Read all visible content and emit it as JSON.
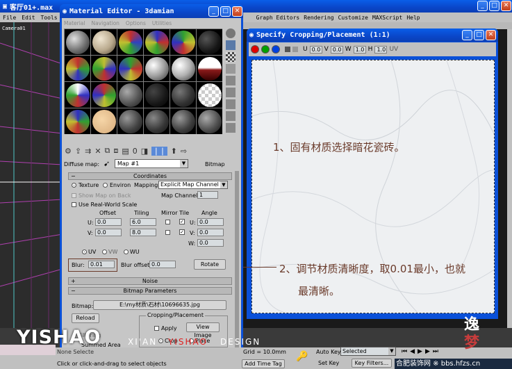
{
  "main": {
    "title": "客厅01+.max",
    "menu": [
      "File",
      "Edit",
      "Tools"
    ],
    "menu_right": [
      "Graph Editors",
      "Rendering",
      "Customize",
      "MAXScript",
      "Help"
    ],
    "viewport_label": "Camera01"
  },
  "material_editor": {
    "title": "Material Editor - 3damian",
    "menu": [
      "Material",
      "Navigation",
      "Options",
      "Utilities"
    ],
    "diffuse_label": "Diffuse map:",
    "map_name": "Map #1",
    "map_type": "Bitmap",
    "coordinates": {
      "header": "Coordinates",
      "texture": "Texture",
      "environ": "Environ",
      "mapping_label": "Mapping:",
      "mapping_value": "Explicit Map Channel",
      "show_map": "Show Map on Back",
      "map_channel_label": "Map Channel:",
      "map_channel": "1",
      "real_world": "Use Real-World Scale",
      "offset": "Offset",
      "tiling": "Tiling",
      "mirror_tile": "Mirror Tile",
      "angle": "Angle",
      "u": "U:",
      "v": "V:",
      "w": "W:",
      "u_offset": "0.0",
      "v_offset": "0.0",
      "u_tiling": "6.0",
      "v_tiling": "8.0",
      "u_angle": "0.0",
      "v_angle": "0.0",
      "w_angle": "0.0",
      "uv": "UV",
      "vw": "VW",
      "wu": "WU",
      "blur_label": "Blur:",
      "blur": "0.01",
      "blur_offset_label": "Blur offset:",
      "blur_offset": "0.0",
      "rotate": "Rotate"
    },
    "noise": "Noise",
    "bitmap_params": "Bitmap Parameters",
    "bitmap_label": "Bitmap:",
    "bitmap_path": "E:\\my材质\\石材\\10696635.jpg",
    "reload": "Reload",
    "filtering": "Filtering",
    "summed_area": "Summed Area",
    "cropping": "Cropping/Placement",
    "apply": "Apply",
    "view_image": "View Image",
    "crop": "Crop",
    "place": "Place"
  },
  "crop_window": {
    "title": "Specify Cropping/Placement (1:1)",
    "u_label": "U",
    "u_val": "0.0",
    "v_label": "V",
    "v_val": "0.0",
    "w_label": "W",
    "w_val": "1.0",
    "h_label": "H",
    "h_val": "1.0",
    "uv_label": "UV"
  },
  "annotations": {
    "step1": "1、固有材质选择暗花瓷砖。",
    "step2_line1": "2、调节材质清晰度，取0.01最小，也就",
    "step2_line2": "最清晰。"
  },
  "status": {
    "prompt": "Click or click-and-drag to select objects",
    "grid": "Grid = 10.0mm",
    "auto_key": "Auto Key",
    "selected": "Selected",
    "set_key": "Set Key",
    "key_filters": "Key Filters...",
    "add_time_tag": "Add Time Tag",
    "none_selected": "None Selecte"
  },
  "watermark": {
    "brand": "YISHAO",
    "city": "XI'AN",
    "design": "DESIGN",
    "site": "合肥装饰网 ※ bbs.hfzs.cn"
  },
  "colors": {
    "xp_blue": "#0a50d8",
    "marble": "#eef0f2",
    "annotation": "#6a3a2a"
  }
}
